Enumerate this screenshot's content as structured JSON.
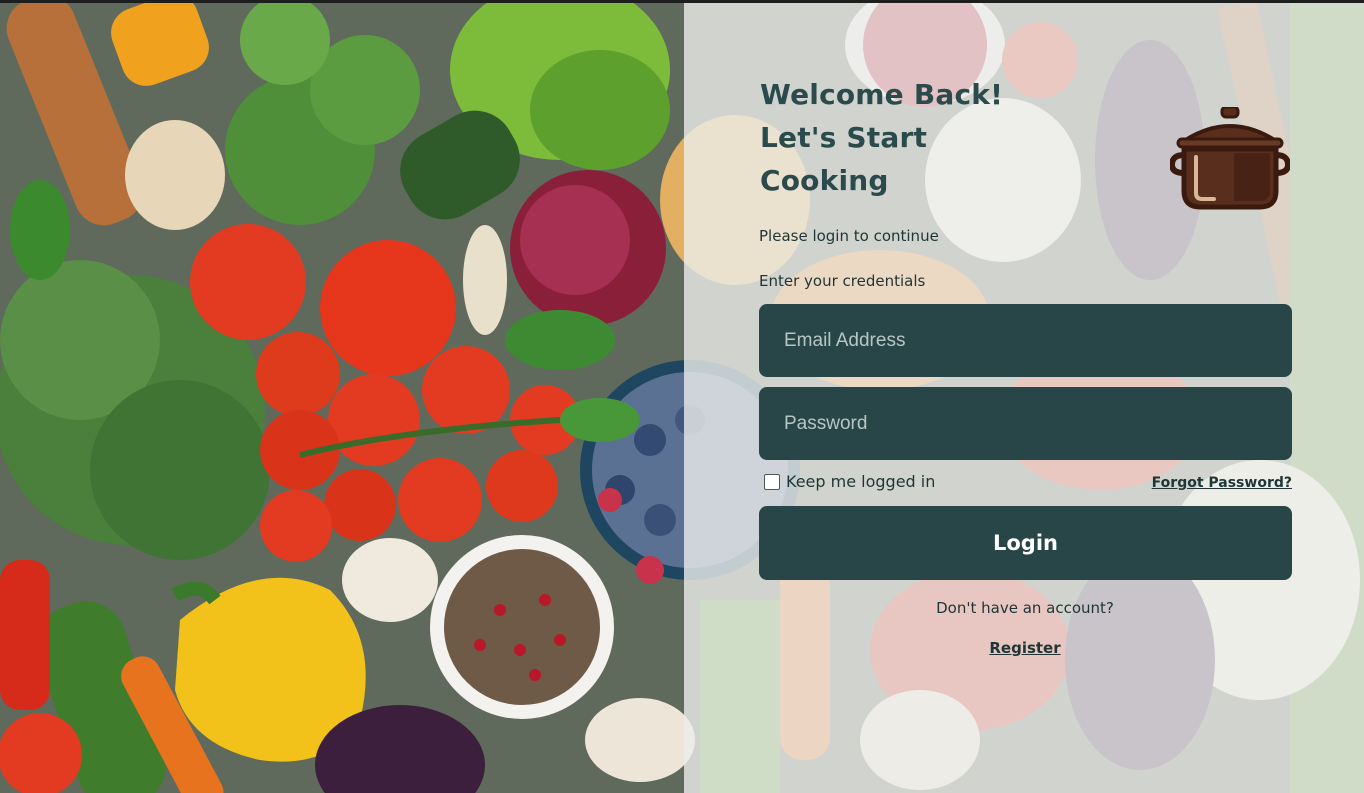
{
  "login": {
    "heading_line1": "Welcome Back!",
    "heading_line2": "Let's Start",
    "heading_line3": "Cooking",
    "prompt": "Please login to continue",
    "credentials_label": "Enter your credentials",
    "email_placeholder": "Email Address",
    "password_placeholder": "Password",
    "remember_label": "Keep me logged in",
    "remember_checked": false,
    "forgot_label": "Forgot Password?",
    "login_label": "Login",
    "no_account_text": "Don't have an account?",
    "register_label": "Register"
  },
  "icons": {
    "logo": "cooking-pot-icon",
    "checkbox": "checkbox-icon"
  },
  "colors": {
    "primary": "#284648",
    "heading": "#2b4a4c",
    "text": "#1f3536",
    "pot_body": "#5a2e1c",
    "pot_outline": "#3a1a0e",
    "panel_overlay": "rgba(236,238,235,0.80)"
  }
}
